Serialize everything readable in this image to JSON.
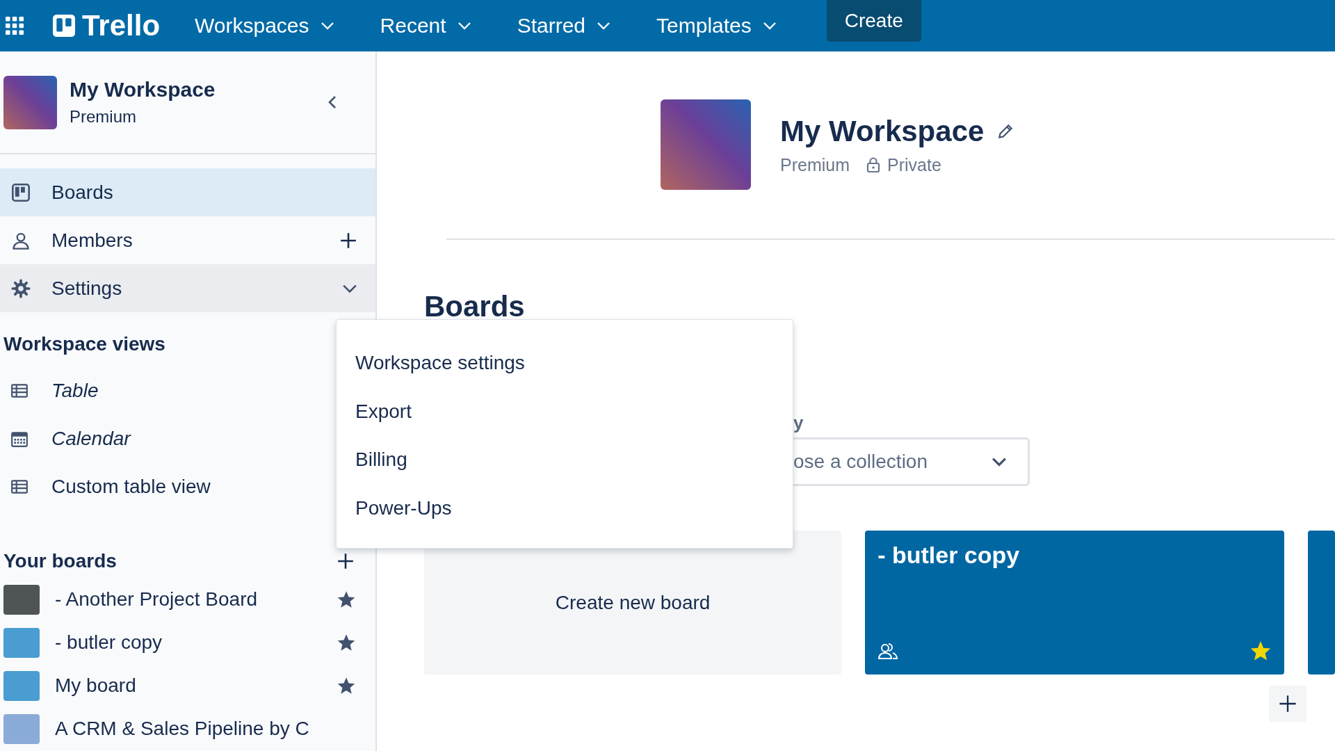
{
  "topbar": {
    "logo": "Trello",
    "menus": [
      {
        "label": "Workspaces"
      },
      {
        "label": "Recent"
      },
      {
        "label": "Starred"
      },
      {
        "label": "Templates"
      }
    ],
    "create": "Create"
  },
  "sidebar": {
    "workspace": {
      "name": "My Workspace",
      "plan": "Premium"
    },
    "nav": [
      {
        "kind": "boards",
        "label": "Boards",
        "selected": true,
        "expanded": false
      },
      {
        "kind": "members",
        "label": "Members",
        "selected": false,
        "expanded": false
      },
      {
        "kind": "settings",
        "label": "Settings",
        "selected": false,
        "expanded": true
      }
    ],
    "views_heading": "Workspace views",
    "views": [
      {
        "label": "Table",
        "italic": true
      },
      {
        "label": "Calendar",
        "italic": true,
        "kind": "calendar"
      },
      {
        "label": "Custom table view",
        "italic": false
      }
    ],
    "boards_heading": "Your boards",
    "boards": [
      {
        "name": "- Another Project Board",
        "color": "#4f5456",
        "starred": true
      },
      {
        "name": "- butler copy",
        "color": "#4a9dd1",
        "starred": true
      },
      {
        "name": "My board",
        "color": "#4a9dd1",
        "starred": true
      },
      {
        "name": "A CRM & Sales Pipeline by C",
        "color": "#8aaad8",
        "starred": false
      }
    ]
  },
  "main": {
    "title": "My Workspace",
    "plan": "Premium",
    "visibility": "Private",
    "boards_heading": "Boards",
    "filter_label": "y",
    "collection_select": {
      "value": "ose a collection"
    },
    "create_board": "Create new board",
    "cards": [
      {
        "name": "- butler copy",
        "color": "#0067a3",
        "starred": true
      }
    ]
  },
  "settings_menu": {
    "items": [
      {
        "label": "Workspace settings"
      },
      {
        "label": "Export"
      },
      {
        "label": "Billing"
      },
      {
        "label": "Power-Ups"
      }
    ]
  }
}
